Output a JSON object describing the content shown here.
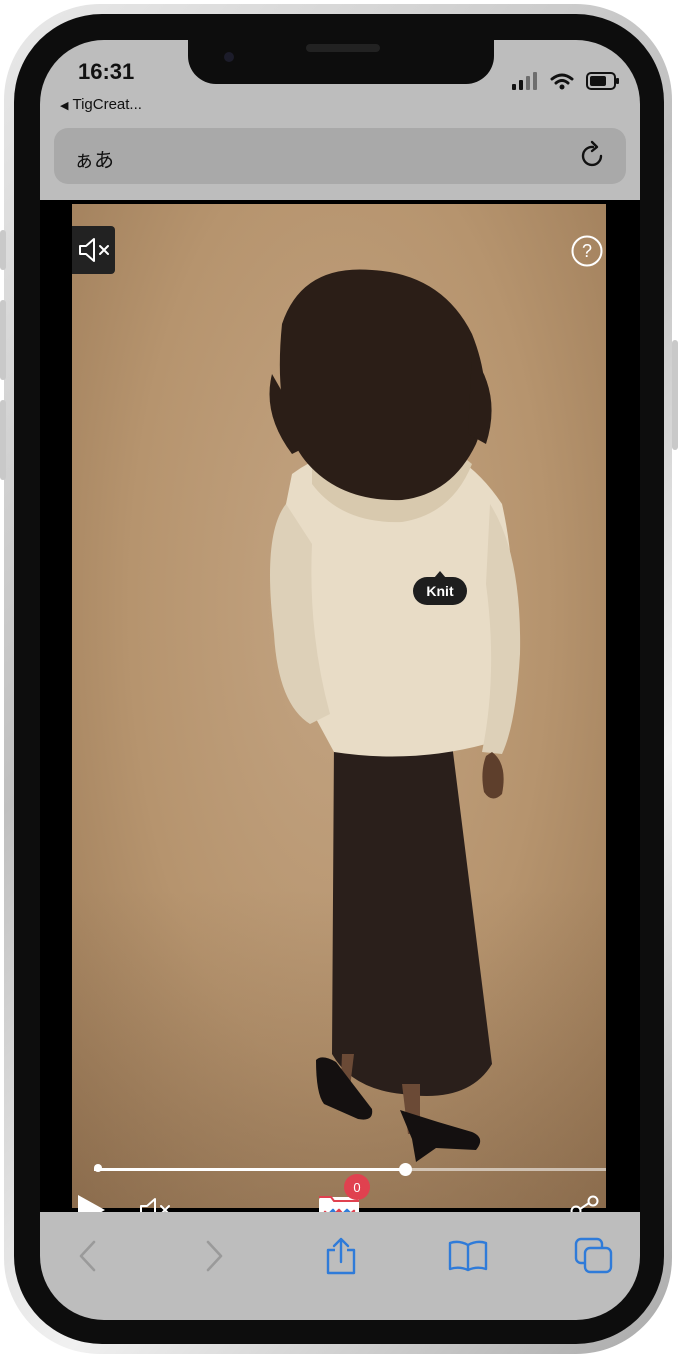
{
  "status_bar": {
    "time": "16:31",
    "back_app": "TigCreat..."
  },
  "address_bar": {
    "text_size_label": "ぁあ"
  },
  "video": {
    "product_tag": "Knit",
    "progress": 0.57
  },
  "player_controls": {
    "cart_count": "0"
  },
  "icons": {
    "status": [
      "signal-icon",
      "wifi-icon",
      "battery-icon"
    ],
    "toolbar": [
      "back-icon",
      "forward-icon",
      "share-icon",
      "bookmarks-icon",
      "tabs-icon"
    ]
  },
  "colors": {
    "accent": "#2f7bd9",
    "badge": "#e0414f",
    "chrome": "#bdbdbd"
  }
}
